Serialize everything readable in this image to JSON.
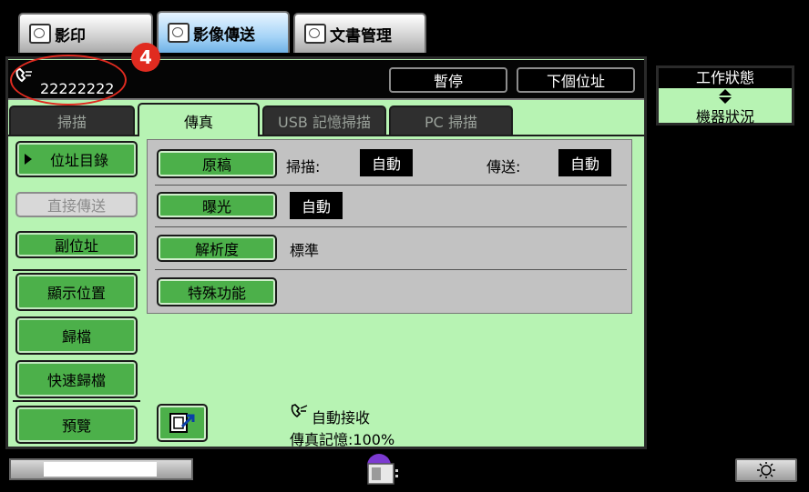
{
  "mode_tabs": [
    {
      "label": "影印"
    },
    {
      "label": "影像傳送"
    },
    {
      "label": "文書管理"
    }
  ],
  "callout_number": "4",
  "address": {
    "value": "22222222"
  },
  "header_buttons": {
    "pause": "暫停",
    "next_address": "下個位址"
  },
  "status_panel": {
    "job_status": "工作狀態",
    "machine_status": "機器狀況"
  },
  "fax_tabs": [
    {
      "label": "掃描"
    },
    {
      "label": "傳真"
    },
    {
      "label": "USB 記憶掃描"
    },
    {
      "label": "PC 掃描"
    }
  ],
  "side_buttons": {
    "address_book": "位址目錄",
    "direct_send": "直接傳送",
    "sub_address": "副位址",
    "display_position": "顯示位置",
    "file": "歸檔",
    "quick_file": "快速歸檔",
    "preview": "預覽"
  },
  "settings": {
    "original": {
      "button": "原稿",
      "scan_label": "掃描:",
      "scan_value": "自動",
      "send_label": "傳送:",
      "send_value": "自動"
    },
    "exposure": {
      "button": "曝光",
      "value": "自動"
    },
    "resolution": {
      "button": "解析度",
      "value": "標準"
    },
    "special": {
      "button": "特殊功能"
    }
  },
  "status_info": {
    "auto_receive": "自動接收",
    "memory_label": "傳真記憶:",
    "memory_value": "100%"
  },
  "colors": {
    "panel_green": "#b7f3b3",
    "button_green": "#4cb04a",
    "callout_red": "#e02b20",
    "active_tab_blue": "#8fc7f1"
  }
}
